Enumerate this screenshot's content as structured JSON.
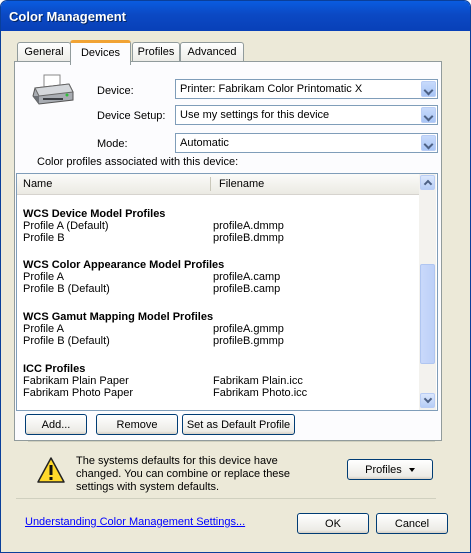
{
  "window": {
    "title": "Color Management"
  },
  "tabs": [
    {
      "label": "General"
    },
    {
      "label": "Devices"
    },
    {
      "label": "Profiles"
    },
    {
      "label": "Advanced"
    }
  ],
  "device": {
    "device_label": "Device:",
    "device_value": "Printer: Fabrikam Color Printomatic X",
    "setup_label": "Device Setup:",
    "setup_value": "Use my settings for this device",
    "mode_label": "Mode:",
    "mode_value": "Automatic"
  },
  "profiles_list": {
    "caption": "Color profiles associated with this device:",
    "col_name": "Name",
    "col_filename": "Filename",
    "groups": [
      {
        "title": "WCS Device Model Profiles",
        "rows": [
          {
            "name": "Profile A (Default)",
            "file": "profileA.dmmp"
          },
          {
            "name": "Profile B",
            "file": "profileB.dmmp"
          }
        ]
      },
      {
        "title": "WCS Color Appearance Model Profiles",
        "rows": [
          {
            "name": "Profile A",
            "file": "profileA.camp"
          },
          {
            "name": "Profile B (Default)",
            "file": "profileB.camp"
          }
        ]
      },
      {
        "title": "WCS Gamut Mapping Model Profiles",
        "rows": [
          {
            "name": "Profile A",
            "file": "profileA.gmmp"
          },
          {
            "name": "Profile B (Default)",
            "file": "profileB.gmmp"
          }
        ]
      },
      {
        "title": "ICC Profiles",
        "rows": [
          {
            "name": "Fabrikam Plain Paper",
            "file": "Fabrikam Plain.icc"
          },
          {
            "name": "Fabrikam Photo Paper",
            "file": "Fabrikam Photo.icc"
          }
        ]
      }
    ]
  },
  "actions": {
    "add": "Add...",
    "remove": "Remove",
    "set_default": "Set as Default Profile"
  },
  "message": {
    "line1": "The systems defaults for this device have",
    "line2": "changed. You can combine or replace these",
    "line3": "settings with system defaults.",
    "profiles_button": "Profiles"
  },
  "footer": {
    "link": "Understanding Color Management Settings...",
    "ok": "OK",
    "cancel": "Cancel"
  },
  "colors": {
    "title_bar": "#0b49c4",
    "active_tab_accent": "#f1a334",
    "link": "#0000ff"
  }
}
